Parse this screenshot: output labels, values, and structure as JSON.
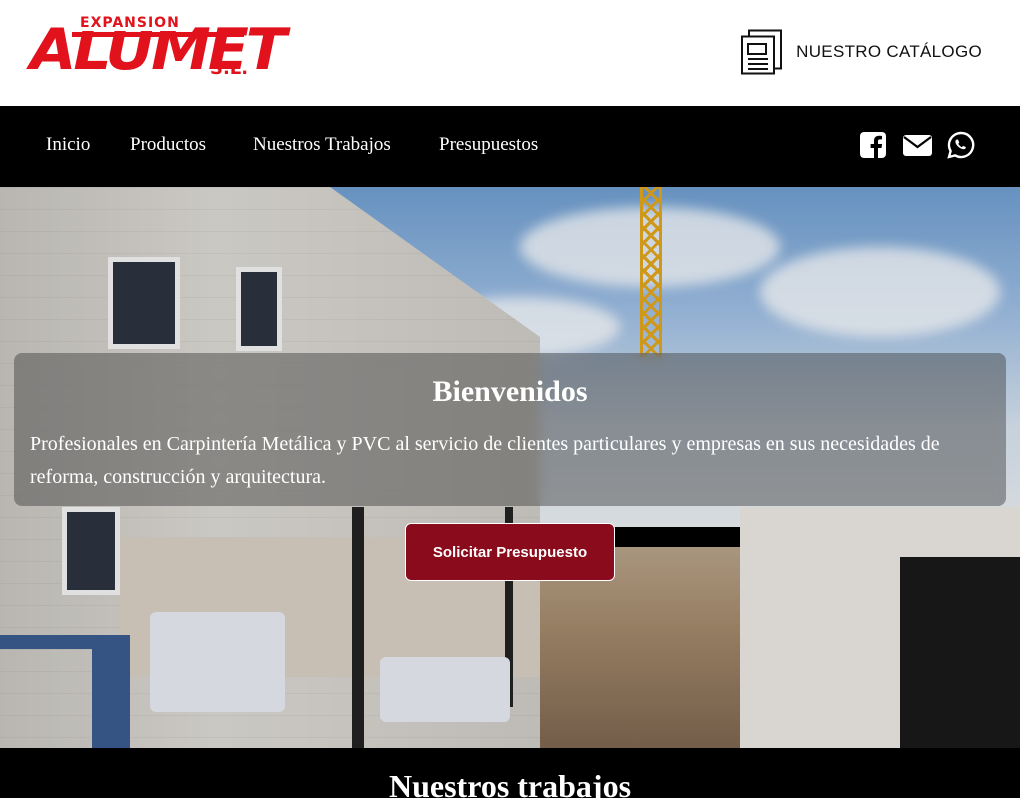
{
  "header": {
    "logo": {
      "line1": "EXPANSION",
      "main": "ALUMET",
      "suffix": "S.L.",
      "color": "#e1121b"
    },
    "catalog_label": "NUESTRO CATÁLOGO",
    "catalog_icon": "document-icon"
  },
  "nav": {
    "items": [
      "Inicio",
      "Productos",
      "Nuestros Trabajos",
      "Presupuestos"
    ],
    "social_icons": [
      "facebook-icon",
      "email-icon",
      "whatsapp-icon"
    ]
  },
  "hero": {
    "title": "Bienvenidos",
    "text": "Profesionales en Carpintería Metálica y PVC al servicio de clientes particulares y empresas en sus necesidades de reforma, construcción y arquitectura.",
    "cta_label": "Solicitar Presupuesto",
    "cta_color": "#8a0b1c"
  },
  "section": {
    "title": "Nuestros trabajos"
  }
}
